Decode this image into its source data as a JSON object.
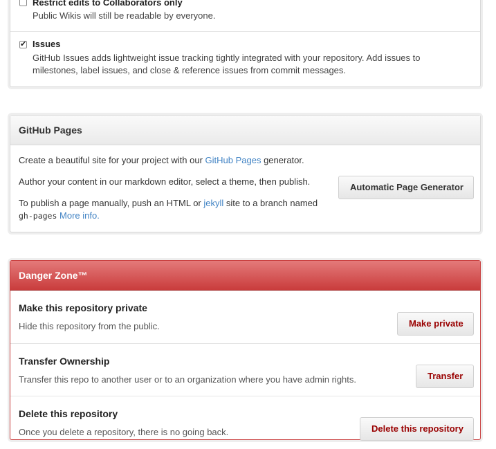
{
  "features": {
    "restrict_wiki": {
      "label": "Restrict edits to Collaborators only",
      "description": "Public Wikis will still be readable by everyone.",
      "checked": false
    },
    "issues": {
      "label": "Issues",
      "description_line1": "GitHub Issues adds lightweight issue tracking tightly integrated with your repository. Add issues to",
      "description_line2": "milestones, label issues, and close & reference issues from commit messages.",
      "checked": true,
      "check_glyph": "✔"
    }
  },
  "pages": {
    "title": "GitHub Pages",
    "line1_pre": "Create a beautiful site for your project with our ",
    "line1_link": "GitHub Pages",
    "line1_post": " generator.",
    "line2": "Author your content in our markdown editor, select a theme, then publish.",
    "line3_pre": "To publish a page manually, push an HTML or ",
    "line3_link": "jekyll",
    "line3_post": " site to a branch named",
    "line4_code": "gh-pages",
    "line4_link": "More info.",
    "generator_button": "Automatic Page Generator"
  },
  "danger": {
    "title": "Danger Zone™",
    "items": [
      {
        "title": "Make this repository private",
        "description": "Hide this repository from the public.",
        "button": "Make private"
      },
      {
        "title": "Transfer Ownership",
        "description": "Transfer this repo to another user or to an organization where you have admin rights.",
        "button": "Transfer"
      },
      {
        "title": "Delete this repository",
        "description": "Once you delete a repository, there is no going back.",
        "button": "Delete this repository"
      }
    ]
  },
  "colors": {
    "link": "#4183c4",
    "danger_header": "#c93c3c",
    "danger_button_text": "#990000"
  }
}
